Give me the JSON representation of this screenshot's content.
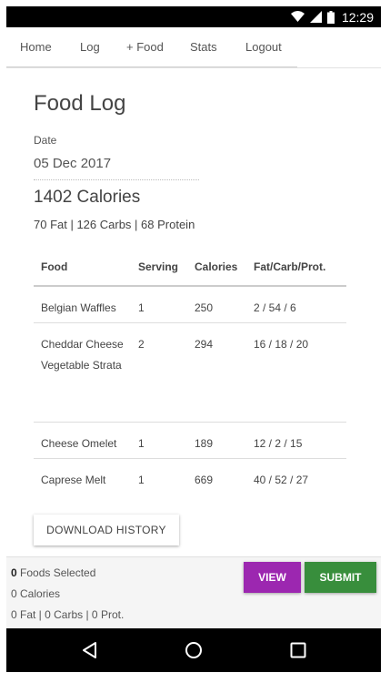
{
  "status_bar": {
    "time": "12:29",
    "icons": [
      "wifi-icon",
      "signal-icon",
      "battery-icon"
    ]
  },
  "nav": {
    "items": [
      "Home",
      "Log",
      "+ Food",
      "Stats",
      "Logout"
    ]
  },
  "page": {
    "title": "Food Log",
    "date_label": "Date",
    "date_value": "05 Dec 2017",
    "calories_total": "1402 Calories",
    "macros_total": "70 Fat | 126 Carbs | 68 Protein"
  },
  "table": {
    "headers": [
      "Food",
      "Serving",
      "Calories",
      "Fat/Carb/Prot."
    ],
    "rows": [
      [
        "Belgian Waffles",
        "1",
        "250",
        "2 / 54 / 6"
      ],
      [
        "Cheddar Cheese Vegetable Strata",
        "2",
        "294",
        "16 / 18 / 20"
      ],
      [
        "Cheese Omelet",
        "1",
        "189",
        "12 / 2 / 15"
      ],
      [
        "Caprese Melt",
        "1",
        "669",
        "40 / 52 / 27"
      ]
    ]
  },
  "download_label": "DOWNLOAD HISTORY",
  "selection": {
    "count": "0",
    "count_suffix": " Foods Selected",
    "calories": "0 Calories",
    "macros": "0 Fat | 0 Carbs | 0 Prot."
  },
  "actions": {
    "view": "VIEW",
    "submit": "SUBMIT"
  },
  "colors": {
    "view": "#9c27b0",
    "submit": "#388e3c",
    "bars": "#000000"
  },
  "android_nav": [
    "back-icon",
    "home-icon",
    "recents-icon"
  ]
}
